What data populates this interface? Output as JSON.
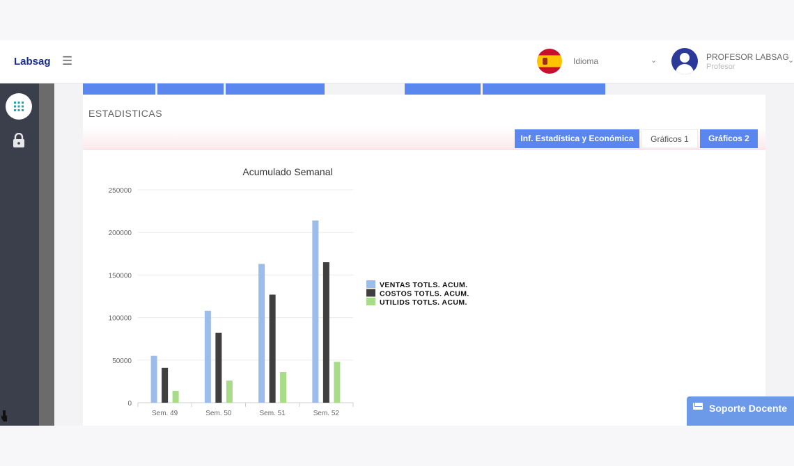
{
  "app": {
    "brand": "Labsag"
  },
  "header": {
    "language_label": "Idioma",
    "user_name": "PROFESOR LABSAG",
    "user_role": "Profesor"
  },
  "panel": {
    "title": "ESTADISTICAS",
    "buttons": {
      "inf": "Inf. Estadística y Económica",
      "graficos1": "Gráficos 1",
      "graficos2": "Gráficos 2"
    }
  },
  "support": {
    "label": "Soporte Docente"
  },
  "colors": {
    "accent": "#5a86f0",
    "ventas": "#9cbcea",
    "costos": "#3f3f3f",
    "utilids": "#a8dc88"
  },
  "chart_data": {
    "type": "bar",
    "title": "Acumulado Semanal",
    "categories": [
      "Sem. 49",
      "Sem. 50",
      "Sem. 51",
      "Sem. 52"
    ],
    "series": [
      {
        "name": "VENTAS TOTLS. ACUM.",
        "values": [
          55000,
          108000,
          163000,
          214000
        ]
      },
      {
        "name": "COSTOS TOTLS. ACUM.",
        "values": [
          41000,
          82000,
          127000,
          165000
        ]
      },
      {
        "name": "UTILIDS TOTLS. ACUM.",
        "values": [
          14000,
          26000,
          36000,
          48000
        ]
      }
    ],
    "yticks": [
      "0",
      "50000",
      "100000",
      "150000",
      "200000",
      "250000"
    ],
    "ylim": [
      0,
      250000
    ],
    "grid": true,
    "legend": "right"
  }
}
